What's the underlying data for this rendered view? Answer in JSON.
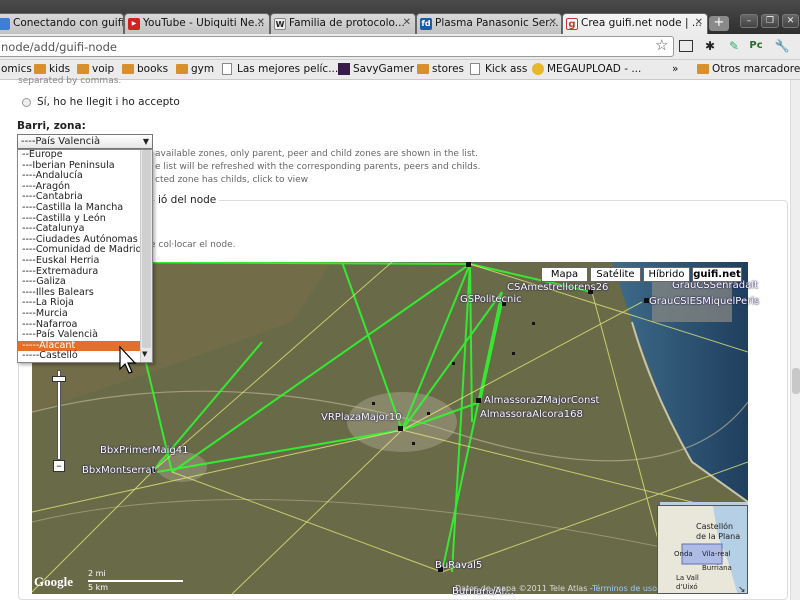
{
  "tabs": [
    {
      "label": "Conectando con guifi...",
      "icon": "guifi-favicon",
      "icon_color": "#3d7fd6"
    },
    {
      "label": "YouTube - Ubiquiti Ne...",
      "icon": "youtube-favicon",
      "icon_color": "#d12222"
    },
    {
      "label": "Familia de protocolo...",
      "icon": "wikipedia-favicon",
      "icon_color": "#eeeeee"
    },
    {
      "label": "Plasma Panasonic Ser...",
      "icon": "fd-favicon",
      "icon_color": "#1e5aa8"
    },
    {
      "label": "Crea guifi.net node | ...",
      "icon": "guifi-g-favicon",
      "icon_color": "#c33b2b"
    }
  ],
  "window_buttons": {
    "new_tab": "+",
    "minimize": "–",
    "restore": "❐",
    "close": "✕"
  },
  "address": "node/add/guifi-node",
  "bookmarks": [
    {
      "label": "omics",
      "icon": "none"
    },
    {
      "label": "kids",
      "icon": "folder"
    },
    {
      "label": "voip",
      "icon": "folder"
    },
    {
      "label": "books",
      "icon": "folder"
    },
    {
      "label": "gym",
      "icon": "folder"
    },
    {
      "label": "Las mejores pelíc...",
      "icon": "page"
    },
    {
      "label": "SavyGamer",
      "icon": "savygamer"
    },
    {
      "label": "stores",
      "icon": "folder"
    },
    {
      "label": "Kick ass",
      "icon": "page"
    },
    {
      "label": "MEGAUPLOAD - ...",
      "icon": "megaupload"
    },
    {
      "label": "Otros marcadores",
      "icon": "folder"
    }
  ],
  "bookmarks_overflow": "»",
  "form": {
    "truncated_top": "separated by commas.",
    "radio_label": "Sí, ho he llegit i ho accepto",
    "zone_label": "Barri, zona:",
    "zone_selected": "----País Valencià",
    "zone_notes": [
      "available zones, only parent, peer and child zones are shown in the list.",
      "e list will be refreshed with the corresponding parents, peers and childs.",
      "cted zone has childs, click to view"
    ],
    "section_title": "ió del node",
    "section_hint": "e col·locar el node."
  },
  "zone_options": [
    "--Europe",
    "---Iberian Peninsula",
    "----Andalucía",
    "----Aragón",
    "----Cantabria",
    "----Castilla la Mancha",
    "----Castilla y León",
    "----Catalunya",
    "----Ciudades Autónomas",
    "----Comunidad de Madrid",
    "----Euskal Herria",
    "----Extremadura",
    "----Galiza",
    "----Illes Balears",
    "----La Rioja",
    "----Murcia",
    "----Nafarroa",
    "----País Valencià",
    "-----Alacant",
    "-----Castelló"
  ],
  "zone_highlighted_index": 18,
  "map": {
    "types": [
      "Mapa",
      "Satélite",
      "Híbrido",
      "guifi.net"
    ],
    "active_type": "guifi.net",
    "node_labels": [
      "CSAmestrellorens26",
      "GrauCSSenradaIt",
      "GSPolitecnic",
      "GrauCSIESMiquelPeris",
      "VRPlazaMajor10",
      "AlmassoraZMajorConst",
      "AlmassoraAlcora168",
      "BbxPrimerMaig41",
      "BbxMontserrat",
      "BuRaval5",
      "BurrianaAl..."
    ],
    "scale_labels": [
      "2 mi",
      "5 km"
    ],
    "google_logo": "Google",
    "copyright": "Datos de mapa ©2011 Tele Atlas -",
    "terms": "Términos de uso",
    "minimap_labels": [
      "Castellón",
      "de la Plana",
      "Onda",
      "Vila-real",
      "Burriana",
      "La Vall",
      "d'Uixó"
    ]
  },
  "colors": {
    "link_green": "#2dff2d",
    "highlight": "#e46f2b",
    "node_label_outline": "#2a1a6a"
  }
}
